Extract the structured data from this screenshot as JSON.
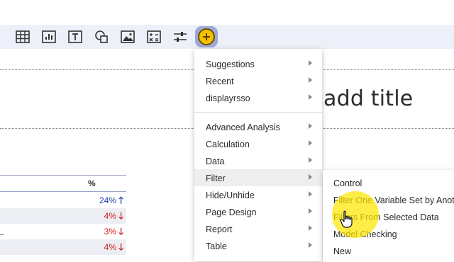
{
  "toolbar": {
    "icons": [
      "table-icon",
      "chart-icon",
      "text-icon",
      "shapes-icon",
      "image-icon",
      "calculation-icon",
      "sliders-icon",
      "plus-icon"
    ]
  },
  "canvas": {
    "title_placeholder": "add title"
  },
  "table": {
    "header": "%",
    "rows": [
      {
        "value": "24%",
        "trend": "up",
        "color": "#1a3fb0"
      },
      {
        "value": "4%",
        "trend": "down",
        "color": "#d11a1a"
      },
      {
        "value": "3%",
        "trend": "down",
        "color": "#d11a1a"
      },
      {
        "value": "4%",
        "trend": "down",
        "color": "#d11a1a"
      }
    ],
    "arrow_up": "🡑",
    "arrow_down": "🡓"
  },
  "menu": {
    "items": [
      {
        "label": "Suggestions",
        "has_submenu": true
      },
      {
        "label": "Recent",
        "has_submenu": true
      },
      {
        "label": "displayrsso",
        "has_submenu": true
      },
      {
        "label": "Advanced Analysis",
        "has_submenu": true
      },
      {
        "label": "Calculation",
        "has_submenu": true
      },
      {
        "label": "Data",
        "has_submenu": true
      },
      {
        "label": "Filter",
        "has_submenu": true,
        "highlighted": true
      },
      {
        "label": "Hide/Unhide",
        "has_submenu": true
      },
      {
        "label": "Page Design",
        "has_submenu": true
      },
      {
        "label": "Report",
        "has_submenu": true
      },
      {
        "label": "Table",
        "has_submenu": true
      }
    ]
  },
  "submenu": {
    "items": [
      {
        "label": "Control"
      },
      {
        "label": "Filter One Variable Set by Anoth"
      },
      {
        "label": "Filters From Selected Data"
      },
      {
        "label": "Model Checking"
      },
      {
        "label": "New"
      }
    ]
  }
}
